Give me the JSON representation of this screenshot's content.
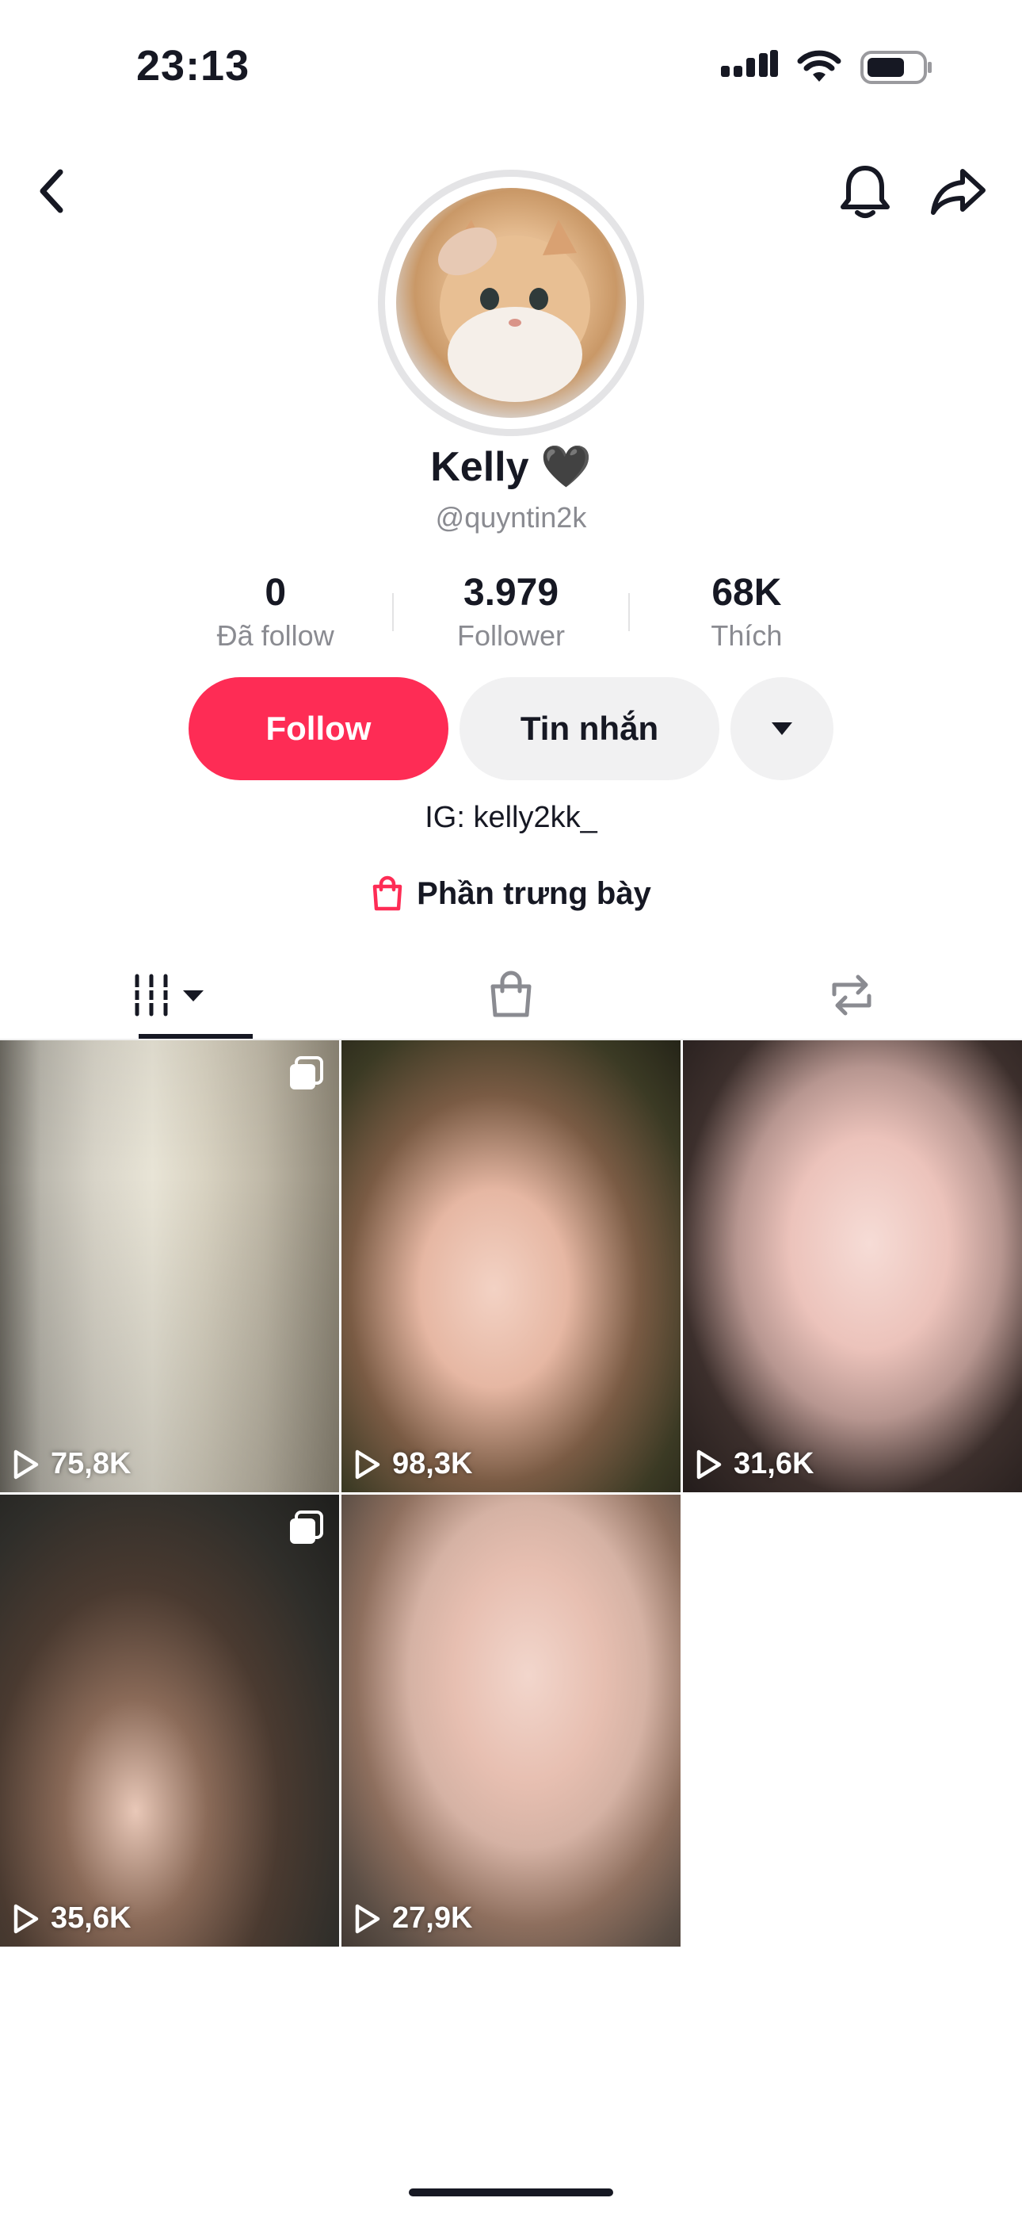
{
  "status_bar": {
    "time": "23:13",
    "icons": [
      "cellular-signal-icon",
      "wifi-icon",
      "battery-icon"
    ]
  },
  "nav": {
    "back_icon": "chevron-left-icon",
    "bell_icon": "bell-icon",
    "share_icon": "share-arrow-icon"
  },
  "profile": {
    "display_name": "Kelly 🖤",
    "username": "@quyntin2k",
    "bio": "IG: kelly2kk_",
    "showcase_label": "Phần trưng bày"
  },
  "stats": [
    {
      "value": "0",
      "label": "Đã follow"
    },
    {
      "value": "3.979",
      "label": "Follower"
    },
    {
      "value": "68K",
      "label": "Thích"
    }
  ],
  "actions": {
    "follow_label": "Follow",
    "message_label": "Tin nhắn"
  },
  "tabs": [
    {
      "name": "videos",
      "icon": "grid-bars-icon"
    },
    {
      "name": "shop",
      "icon": "shopping-bag-icon"
    },
    {
      "name": "reposts",
      "icon": "repost-icon"
    }
  ],
  "videos": [
    {
      "views": "75,8K",
      "multi": true
    },
    {
      "views": "98,3K",
      "multi": false
    },
    {
      "views": "31,6K",
      "multi": false
    },
    {
      "views": "35,6K",
      "multi": true
    },
    {
      "views": "27,9K",
      "multi": false
    }
  ],
  "colors": {
    "accent": "#fe2c55",
    "secondary_button": "#f1f1f2",
    "muted_text": "#8a8b91"
  }
}
